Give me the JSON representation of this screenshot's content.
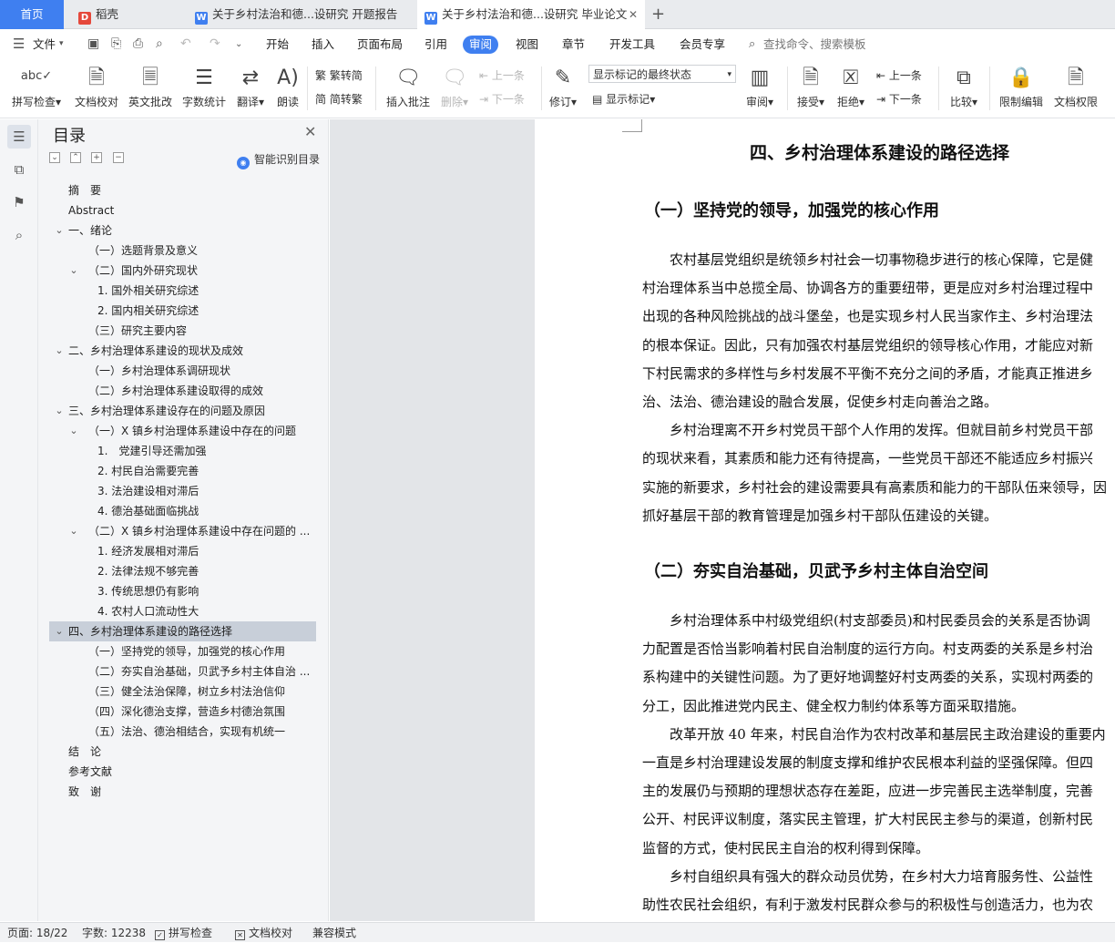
{
  "tabs": [
    {
      "label": "首页"
    },
    {
      "label": "稻壳"
    },
    {
      "label": "关于乡村法治和德...设研究 开题报告"
    },
    {
      "label": "关于乡村法治和德...设研究 毕业论文"
    }
  ],
  "menu": {
    "file": "文件",
    "items": [
      "开始",
      "插入",
      "页面布局",
      "引用",
      "审阅",
      "视图",
      "章节",
      "开发工具",
      "会员专享"
    ],
    "active": "审阅",
    "search_placeholder": "查找命令、搜索模板"
  },
  "ribbon": {
    "spell_check": "拼写检查",
    "doc_proof": "文档校对",
    "en_review": "英文批改",
    "word_count": "字数统计",
    "translate": "翻译",
    "read_aloud": "朗读",
    "to_traditional": "繁转简",
    "to_simplified": "简转繁",
    "insert_comment": "插入批注",
    "delete": "删除",
    "prev": "上一条",
    "next": "下一条",
    "revise": "修订",
    "markup_mode": "显示标记的最终状态",
    "show_markup": "显示标记",
    "review": "审阅",
    "accept": "接受",
    "reject": "拒绝",
    "prev2": "上一条",
    "next2": "下一条",
    "compare": "比较",
    "restrict_edit": "限制编辑",
    "doc_rights": "文档权限",
    "abc": "abc"
  },
  "toc": {
    "title": "目录",
    "smart": "智能识别目录",
    "items": [
      {
        "text": "摘　要",
        "level": 0
      },
      {
        "text": "Abstract",
        "level": 0
      },
      {
        "text": "一、绪论",
        "level": 0,
        "toggle": true
      },
      {
        "text": "（一）选题背景及意义",
        "level": 1
      },
      {
        "text": "（二）国内外研究现状",
        "level": 1,
        "toggle": true
      },
      {
        "text": "1. 国外相关研究综述",
        "level": 2
      },
      {
        "text": "2. 国内相关研究综述",
        "level": 2
      },
      {
        "text": "（三）研究主要内容",
        "level": 1
      },
      {
        "text": "二、乡村治理体系建设的现状及成效",
        "level": 0,
        "toggle": true
      },
      {
        "text": "（一）乡村治理体系调研现状",
        "level": 1
      },
      {
        "text": "（二）乡村治理体系建设取得的成效",
        "level": 1
      },
      {
        "text": "三、乡村治理体系建设存在的问题及原因",
        "level": 0,
        "toggle": true
      },
      {
        "text": "（一）X 镇乡村治理体系建设中存在的问题",
        "level": 1,
        "toggle": true
      },
      {
        "text": "1.　党建引导还需加强",
        "level": 2
      },
      {
        "text": "2. 村民自治需要完善",
        "level": 2
      },
      {
        "text": "3. 法治建设相对滞后",
        "level": 2
      },
      {
        "text": "4. 德治基础面临挑战",
        "level": 2
      },
      {
        "text": "（二）X 镇乡村治理体系建设中存在问题的 ...",
        "level": 1,
        "toggle": true
      },
      {
        "text": "1. 经济发展相对滞后",
        "level": 2
      },
      {
        "text": "2. 法律法规不够完善",
        "level": 2
      },
      {
        "text": "3. 传统思想仍有影响",
        "level": 2
      },
      {
        "text": "4. 农村人口流动性大",
        "level": 2
      },
      {
        "text": "四、乡村治理体系建设的路径选择",
        "level": 0,
        "toggle": true,
        "selected": true
      },
      {
        "text": "（一）坚持党的领导，加强党的核心作用",
        "level": 1
      },
      {
        "text": "（二）夯实自治基础，贝武予乡村主体自治 ...",
        "level": 1
      },
      {
        "text": "（三）健全法治保障，树立乡村法治信仰",
        "level": 1
      },
      {
        "text": "（四）深化德治支撑，营造乡村德治氛围",
        "level": 1
      },
      {
        "text": "（五）法治、德治相结合，实现有机统一",
        "level": 1
      },
      {
        "text": "结　论",
        "level": 0
      },
      {
        "text": "参考文献",
        "level": 0
      },
      {
        "text": "致　谢",
        "level": 0
      }
    ]
  },
  "document": {
    "heading": "四、乡村治理体系建设的路径选择",
    "section1_title": "（一）坚持党的领导，加强党的核心作用",
    "section1_lines": [
      "　　农村基层党组织是统领乡村社会一切事物稳步进行的核心保障，它是健",
      "村治理体系当中总揽全局、协调各方的重要纽带，更是应对乡村治理过程中",
      "出现的各种风险挑战的战斗堡垒，也是实现乡村人民当家作主、乡村治理法",
      "的根本保证。因此，只有加强农村基层党组织的领导核心作用，才能应对新",
      "下村民需求的多样性与乡村发展不平衡不充分之间的矛盾，才能真正推进乡",
      "治、法治、德治建设的融合发展，促使乡村走向善治之路。",
      "　　乡村治理离不开乡村党员干部个人作用的发挥。但就目前乡村党员干部",
      "的现状来看，其素质和能力还有待提高，一些党员干部还不能适应乡村振兴",
      "实施的新要求，乡村社会的建设需要具有高素质和能力的干部队伍来领导，因",
      "抓好基层干部的教育管理是加强乡村干部队伍建设的关键。"
    ],
    "section2_title": "（二）夯实自治基础，贝武予乡村主体自治空间",
    "section2_lines": [
      "　　乡村治理体系中村级党组织(村支部委员)和村民委员会的关系是否协调",
      "力配置是否恰当影响着村民自治制度的运行方向。村支两委的关系是乡村治",
      "系构建中的关键性问题。为了更好地调整好村支两委的关系，实现村两委的",
      "分工，因此推进党内民主、健全权力制约体系等方面采取措施。",
      "　　改革开放 40 年来，村民自治作为农村改革和基层民主政治建设的重要内",
      "一直是乡村治理建设发展的制度支撑和维护农民根本利益的坚强保障。但四",
      "主的发展仍与预期的理想状态存在差距，应进一步完善民主选举制度，完善",
      "公开、村民评议制度，落实民主管理，扩大村民民主参与的渠道，创新村民",
      "监督的方式，使村民民主自治的权利得到保障。",
      "　　乡村自组织具有强大的群众动员优势，在乡村大力培育服务性、公益性",
      "助性农民社会组织，有利于激发村民群众参与的积极性与创造活力，也为农"
    ]
  },
  "status": {
    "page": "页面: 18/22",
    "words": "字数: 12238",
    "spell": "拼写检查",
    "proof": "文档校对",
    "compat": "兼容模式"
  },
  "colors": {
    "accent": "#3f7ff0",
    "selected_toc": "#c8cfd9"
  }
}
